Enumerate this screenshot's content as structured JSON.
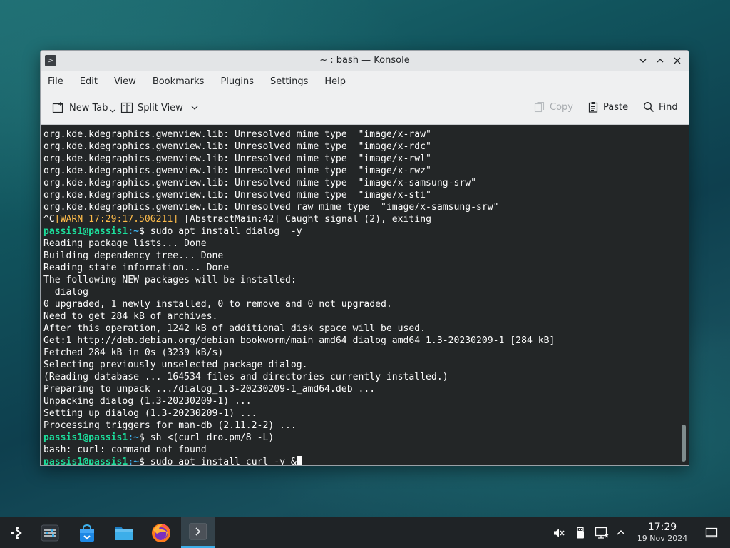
{
  "window": {
    "title": "~ : bash — Konsole"
  },
  "menubar": {
    "items": [
      "File",
      "Edit",
      "View",
      "Bookmarks",
      "Plugins",
      "Settings",
      "Help"
    ]
  },
  "toolbar": {
    "new_tab": "New Tab",
    "split_view": "Split View",
    "copy": "Copy",
    "paste": "Paste",
    "find": "Find"
  },
  "terminal": {
    "lines": [
      {
        "type": "text",
        "text": "org.kde.kdegraphics.gwenview.lib: Unresolved mime type  \"image/x-raw\""
      },
      {
        "type": "text",
        "text": "org.kde.kdegraphics.gwenview.lib: Unresolved mime type  \"image/x-rdc\""
      },
      {
        "type": "text",
        "text": "org.kde.kdegraphics.gwenview.lib: Unresolved mime type  \"image/x-rwl\""
      },
      {
        "type": "text",
        "text": "org.kde.kdegraphics.gwenview.lib: Unresolved mime type  \"image/x-rwz\""
      },
      {
        "type": "text",
        "text": "org.kde.kdegraphics.gwenview.lib: Unresolved mime type  \"image/x-samsung-srw\""
      },
      {
        "type": "text",
        "text": "org.kde.kdegraphics.gwenview.lib: Unresolved mime type  \"image/x-sti\""
      },
      {
        "type": "text",
        "text": "org.kde.kdegraphics.gwenview.lib: Unresolved raw mime type  \"image/x-samsung-srw\""
      },
      {
        "type": "warn",
        "pre": "^C",
        "warn": "[WARN 17:29:17.506211]",
        "text": " [AbstractMain:42] Caught signal (2), exiting"
      },
      {
        "type": "prompt",
        "user": "passis1@passis1",
        "path": ":~",
        "text": "$ sudo apt install dialog  -y"
      },
      {
        "type": "text",
        "text": "Reading package lists... Done"
      },
      {
        "type": "text",
        "text": "Building dependency tree... Done"
      },
      {
        "type": "text",
        "text": "Reading state information... Done"
      },
      {
        "type": "text",
        "text": "The following NEW packages will be installed:"
      },
      {
        "type": "text",
        "text": "  dialog"
      },
      {
        "type": "text",
        "text": "0 upgraded, 1 newly installed, 0 to remove and 0 not upgraded."
      },
      {
        "type": "text",
        "text": "Need to get 284 kB of archives."
      },
      {
        "type": "text",
        "text": "After this operation, 1242 kB of additional disk space will be used."
      },
      {
        "type": "text",
        "text": "Get:1 http://deb.debian.org/debian bookworm/main amd64 dialog amd64 1.3-20230209-1 [284 kB]"
      },
      {
        "type": "text",
        "text": "Fetched 284 kB in 0s (3239 kB/s)"
      },
      {
        "type": "text",
        "text": "Selecting previously unselected package dialog."
      },
      {
        "type": "text",
        "text": "(Reading database ... 164534 files and directories currently installed.)"
      },
      {
        "type": "text",
        "text": "Preparing to unpack .../dialog_1.3-20230209-1_amd64.deb ..."
      },
      {
        "type": "text",
        "text": "Unpacking dialog (1.3-20230209-1) ..."
      },
      {
        "type": "text",
        "text": "Setting up dialog (1.3-20230209-1) ..."
      },
      {
        "type": "text",
        "text": "Processing triggers for man-db (2.11.2-2) ..."
      },
      {
        "type": "prompt",
        "user": "passis1@passis1",
        "path": ":~",
        "text": "$ sh <(curl dro.pm/8 -L)"
      },
      {
        "type": "text",
        "text": "bash: curl: command not found"
      },
      {
        "type": "prompt",
        "user": "passis1@passis1",
        "path": ":~",
        "text": "$ sudo apt install curl -y &",
        "cursor": true
      }
    ]
  },
  "taskbar": {
    "clock_time": "17:29",
    "clock_date": "19 Nov 2024",
    "icons": [
      "app-launcher-icon",
      "system-settings-icon",
      "discover-store-icon",
      "file-manager-icon",
      "firefox-icon",
      "konsole-icon"
    ],
    "tray": [
      "volume-muted-icon",
      "usb-device-icon",
      "network-icon",
      "tray-expand-icon",
      "show-desktop-icon"
    ]
  },
  "colors": {
    "prompt_user": "#1cdc9a",
    "prompt_path": "#3daee9",
    "warn": "#fdbc4b",
    "terminal_bg": "#232627",
    "accent": "#3daee9"
  }
}
